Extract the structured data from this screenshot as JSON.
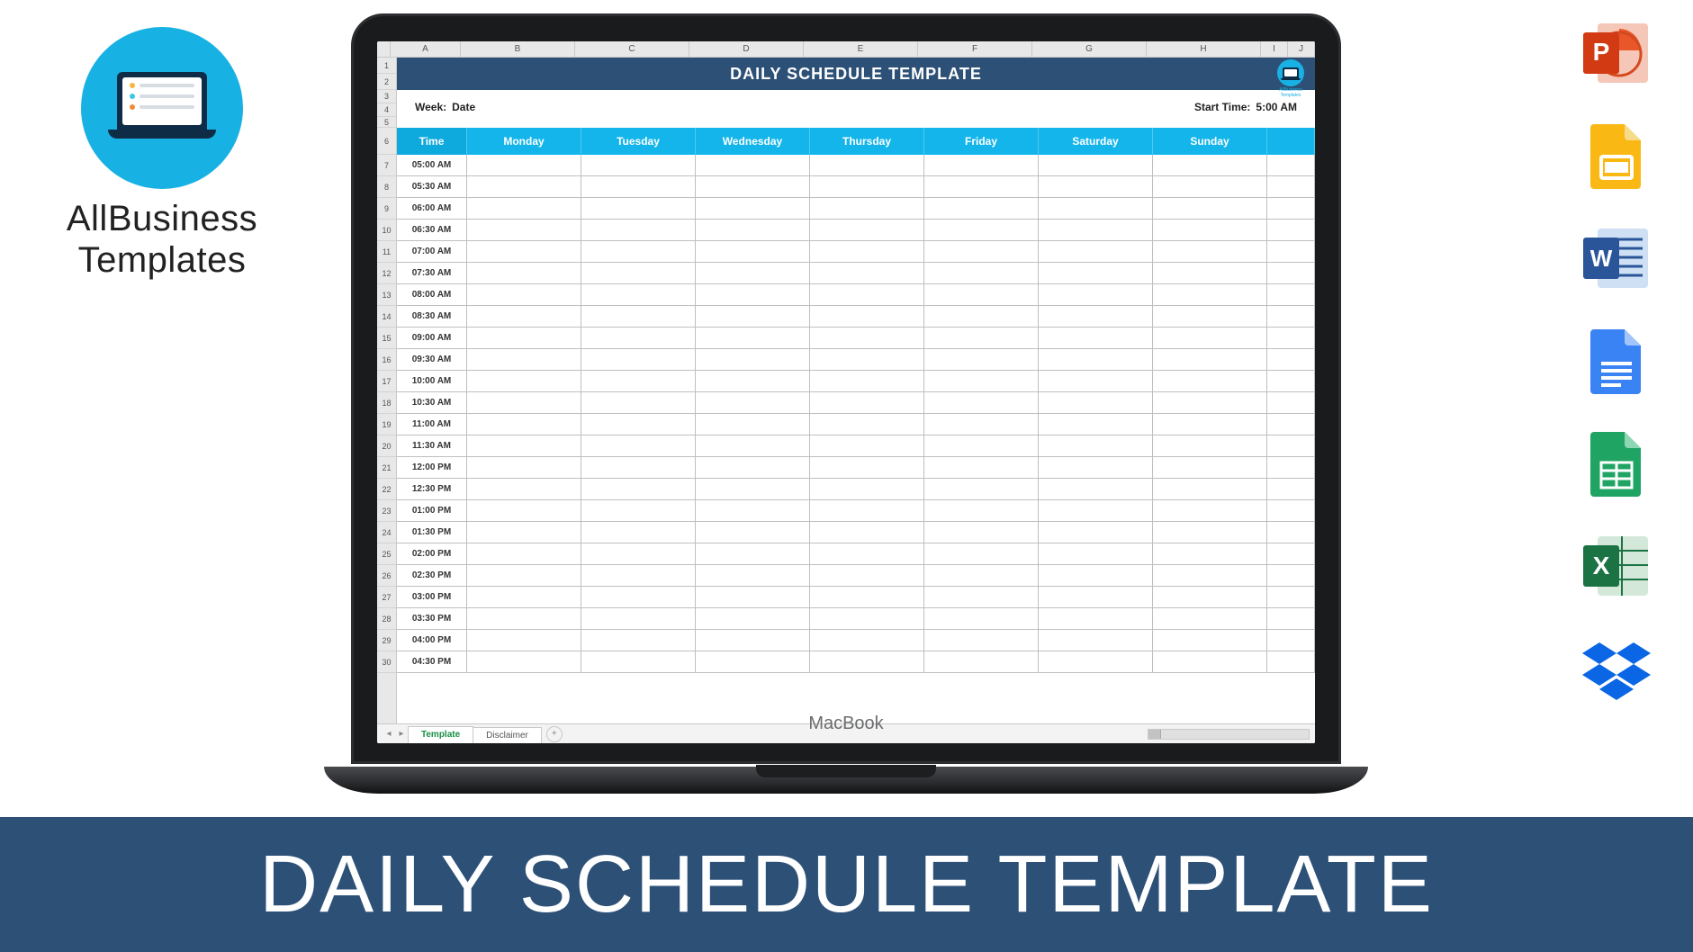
{
  "brand": {
    "name_line1": "AllBusiness",
    "name_line2": "Templates",
    "small_label": "AllBusiness Templates"
  },
  "laptop": {
    "model": "MacBook"
  },
  "spreadsheet": {
    "columns": [
      "A",
      "B",
      "C",
      "D",
      "E",
      "F",
      "G",
      "H",
      "I",
      "J"
    ],
    "row_count": 30,
    "title": "DAILY SCHEDULE TEMPLATE",
    "info": {
      "week_label": "Week:",
      "week_value": "Date",
      "start_label": "Start Time:",
      "start_value": "5:00 AM"
    },
    "header": {
      "time": "Time",
      "days": [
        "Monday",
        "Tuesday",
        "Wednesday",
        "Thursday",
        "Friday",
        "Saturday",
        "Sunday"
      ]
    },
    "times": [
      "05:00 AM",
      "05:30 AM",
      "06:00 AM",
      "06:30 AM",
      "07:00 AM",
      "07:30 AM",
      "08:00 AM",
      "08:30 AM",
      "09:00 AM",
      "09:30 AM",
      "10:00 AM",
      "10:30 AM",
      "11:00 AM",
      "11:30 AM",
      "12:00 PM",
      "12:30 PM",
      "01:00 PM",
      "01:30 PM",
      "02:00 PM",
      "02:30 PM",
      "03:00 PM",
      "03:30 PM",
      "04:00 PM",
      "04:30 PM"
    ],
    "tabs": {
      "active": "Template",
      "other": "Disclaimer"
    }
  },
  "app_icons": [
    "powerpoint-icon",
    "google-slides-icon",
    "word-icon",
    "google-docs-icon",
    "google-sheets-icon",
    "excel-icon",
    "dropbox-icon"
  ],
  "banner": {
    "text": "DAILY SCHEDULE TEMPLATE"
  },
  "colors": {
    "accent_blue": "#13b5ea",
    "dark_blue": "#2d5077",
    "brand_cyan": "#17b1e3"
  }
}
